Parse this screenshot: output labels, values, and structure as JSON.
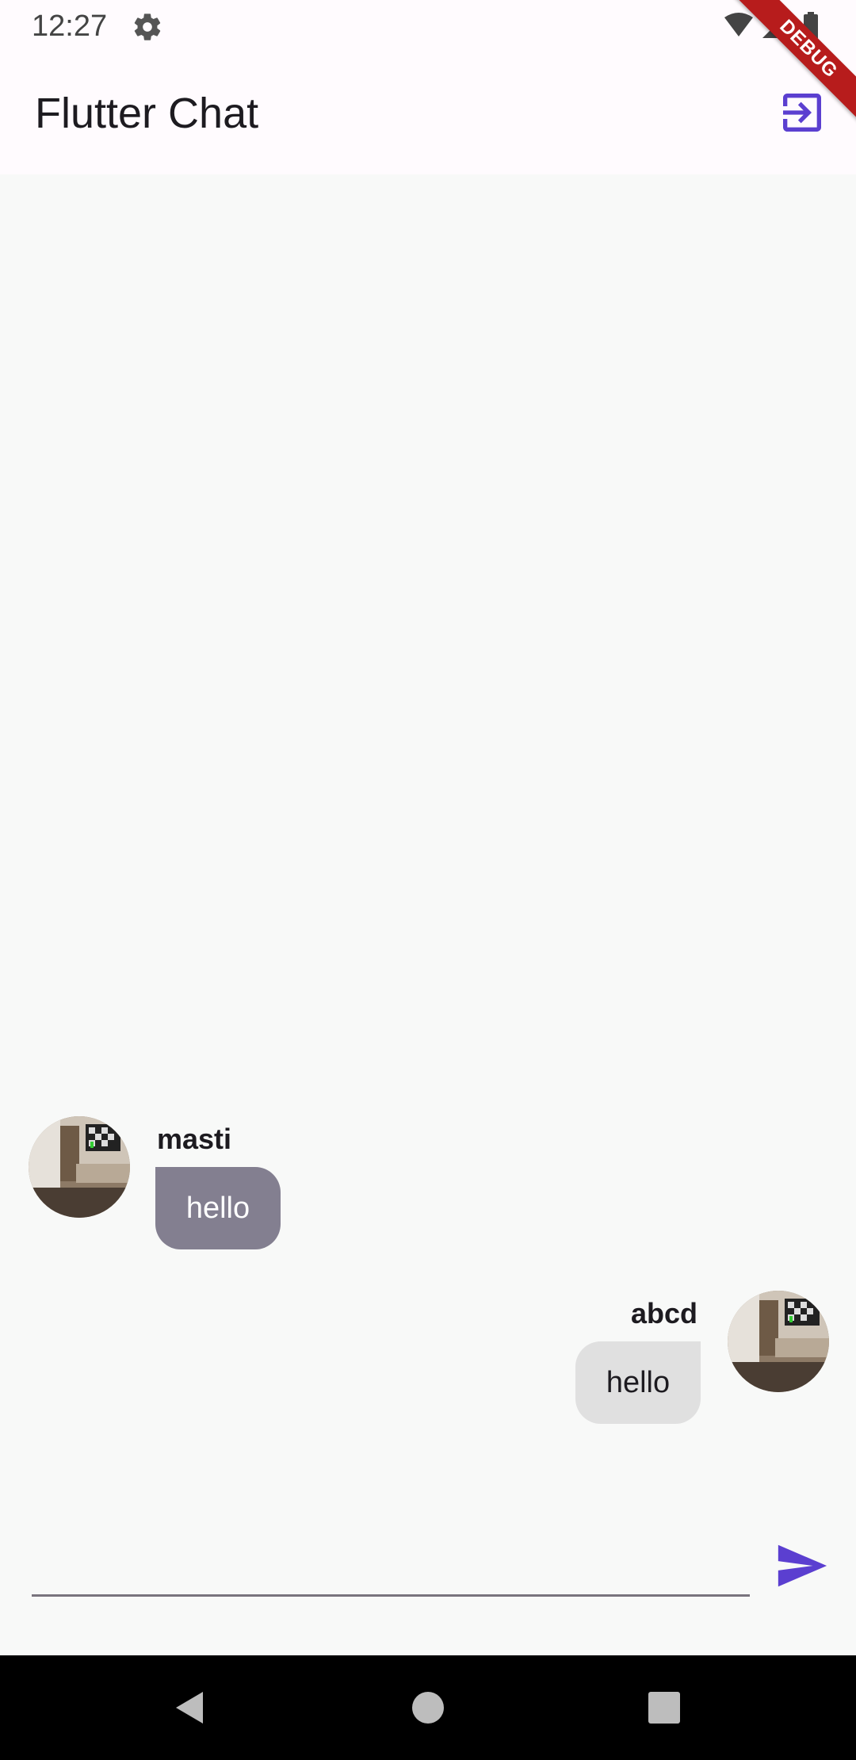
{
  "status_bar": {
    "time": "12:27",
    "icons": [
      "gear-icon",
      "wifi-icon",
      "signal-icon",
      "battery-icon"
    ]
  },
  "app_bar": {
    "title": "Flutter Chat",
    "action_icon": "logout-icon"
  },
  "debug_banner": {
    "label": "DEBUG"
  },
  "messages": [
    {
      "sender": "masti",
      "text": "hello",
      "side": "incoming"
    },
    {
      "sender": "abcd",
      "text": "hello",
      "side": "outgoing"
    }
  ],
  "composer": {
    "input_value": "",
    "placeholder": "",
    "send_icon": "send-icon"
  },
  "nav": {
    "back": "back-icon",
    "home": "home-icon",
    "recents": "recents-icon"
  },
  "colors": {
    "accent": "#5b3fd0",
    "incoming_bubble": "#837f90",
    "outgoing_bubble": "#e0e0e0",
    "debug": "#b71c1c"
  }
}
